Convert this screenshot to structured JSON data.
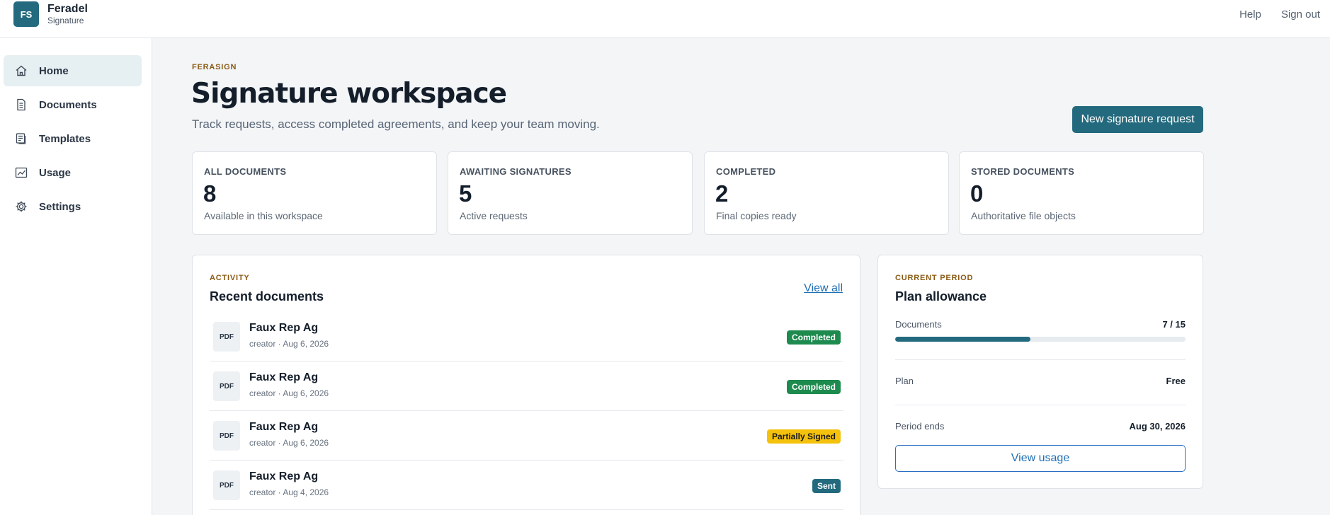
{
  "brand": {
    "logo": "FS",
    "name": "Feradel",
    "subtitle": "Signature"
  },
  "top_links": {
    "help": "Help",
    "sign_out": "Sign out"
  },
  "sidebar": {
    "items": [
      {
        "label": "Home",
        "icon": "home-icon",
        "active": true
      },
      {
        "label": "Documents",
        "icon": "document-icon"
      },
      {
        "label": "Templates",
        "icon": "template-icon"
      },
      {
        "label": "Usage",
        "icon": "chart-icon"
      },
      {
        "label": "Settings",
        "icon": "gear-icon"
      }
    ]
  },
  "header": {
    "eyebrow": "FERASIGN",
    "title": "Signature workspace",
    "subtitle": "Track requests, access completed agreements, and keep your team moving.",
    "new_request_label": "New signature request"
  },
  "stats": [
    {
      "label": "ALL DOCUMENTS",
      "value": "8",
      "desc": "Available in this workspace"
    },
    {
      "label": "AWAITING SIGNATURES",
      "value": "5",
      "desc": "Active requests"
    },
    {
      "label": "COMPLETED",
      "value": "2",
      "desc": "Final copies ready"
    },
    {
      "label": "STORED DOCUMENTS",
      "value": "0",
      "desc": "Authoritative file objects"
    }
  ],
  "activity": {
    "eyebrow": "ACTIVITY",
    "title": "Recent documents",
    "view_all": "View all",
    "documents": [
      {
        "type": "PDF",
        "name": "Faux Rep Ag",
        "meta": "creator · Aug 6, 2026",
        "status": "Completed"
      },
      {
        "type": "PDF",
        "name": "Faux Rep Ag",
        "meta": "creator · Aug 6, 2026",
        "status": "Completed"
      },
      {
        "type": "PDF",
        "name": "Faux Rep Ag",
        "meta": "creator · Aug 6, 2026",
        "status": "Partially Signed"
      },
      {
        "type": "PDF",
        "name": "Faux Rep Ag",
        "meta": "creator · Aug 4, 2026",
        "status": "Sent"
      }
    ]
  },
  "allowance": {
    "eyebrow": "CURRENT PERIOD",
    "title": "Plan allowance",
    "documents_label": "Documents",
    "documents_value": "7 / 15",
    "documents_fraction": 0.467,
    "plan_label": "Plan",
    "plan_value": "Free",
    "period_label": "Period ends",
    "period_value": "Aug 30, 2026",
    "view_usage": "View usage"
  },
  "colors": {
    "accent": "#236a7e",
    "completed": "#1d8a4e",
    "partially_signed": "#f4c20d",
    "sent": "#236a7e",
    "eyebrow": "#8a5a14",
    "link": "#1f6fb5"
  }
}
